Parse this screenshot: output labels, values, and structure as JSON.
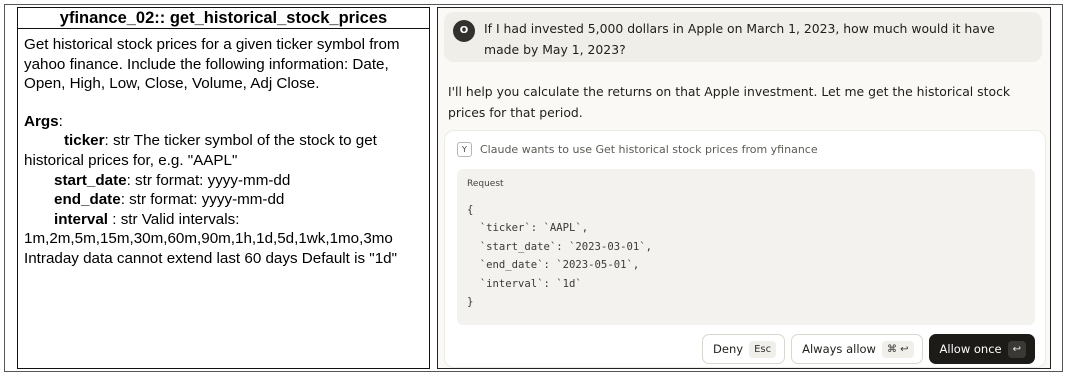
{
  "doc": {
    "title": "yfinance_02:: get_historical_stock_prices",
    "description": "Get historical stock prices for a given ticker symbol from yahoo finance. Include the following information: Date, Open, High, Low, Close, Volume, Adj Close.",
    "args_label": "Args",
    "args_colon": ":",
    "args": [
      {
        "name": "ticker",
        "text": ": str The ticker symbol of the stock to get historical prices for, e.g. \"AAPL\""
      },
      {
        "name": "start_date",
        "text": ": str format: yyyy-mm-dd"
      },
      {
        "name": "end_date",
        "text": ": str format: yyyy-mm-dd"
      },
      {
        "name": "interval",
        "text": " : str Valid intervals: 1m,2m,5m,15m,30m,60m,90m,1h,1d,5d,1wk,1mo,3mo Intraday data cannot extend last 60 days Default is \"1d\""
      }
    ]
  },
  "chat": {
    "user_avatar": "O",
    "user_message": "If I had invested 5,000 dollars in Apple on March 1, 2023, how much would it have made by May 1, 2023?",
    "assistant_message": "I'll help you calculate the returns on that Apple investment. Let me get the historical stock prices for that period.",
    "tool": {
      "icon_letter": "Y",
      "header": "Claude wants to use Get historical stock prices from yfinance",
      "request_label": "Request",
      "code_lines": [
        "{",
        "  `ticker`: `AAPL`,",
        "  `start_date`: `2023-03-01`,",
        "  `end_date`: `2023-05-01`,",
        "  `interval`: `1d`",
        "}"
      ]
    },
    "buttons": {
      "deny": "Deny",
      "deny_key": "Esc",
      "always_allow": "Always allow",
      "always_allow_keys": "⌘ ↩",
      "allow_once": "Allow once",
      "allow_once_key": "↩"
    }
  }
}
